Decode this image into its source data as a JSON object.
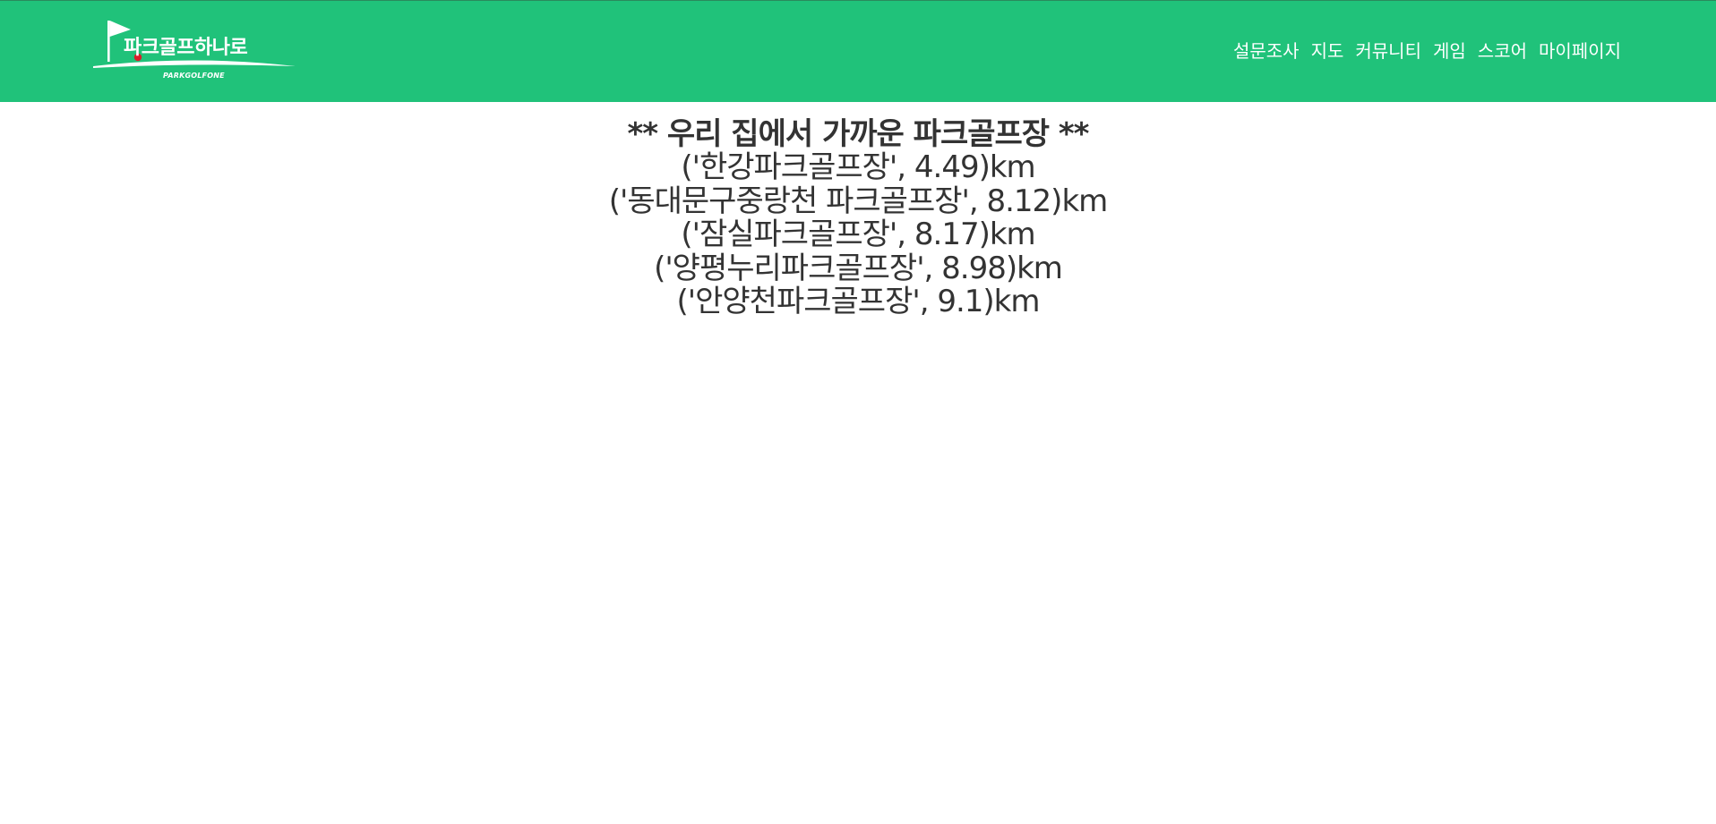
{
  "brand": {
    "name": "파크골프하나로",
    "subtitle": "PARKGOLFONE",
    "colors": {
      "header_bg": "#20c27a",
      "text": "#333333",
      "ball": "#d81e2a"
    }
  },
  "nav": {
    "items": [
      "설문조사",
      "지도",
      "커뮤니티",
      "게임",
      "스코어",
      "마이페이지"
    ]
  },
  "main": {
    "title": "** 우리 집에서 가까운 파크골프장 **",
    "courses": [
      "('한강파크골프장', 4.49)km",
      "('동대문구중랑천 파크골프장', 8.12)km",
      "('잠실파크골프장', 8.17)km",
      "('양평누리파크골프장', 8.98)km",
      "('안양천파크골프장', 9.1)km"
    ]
  }
}
